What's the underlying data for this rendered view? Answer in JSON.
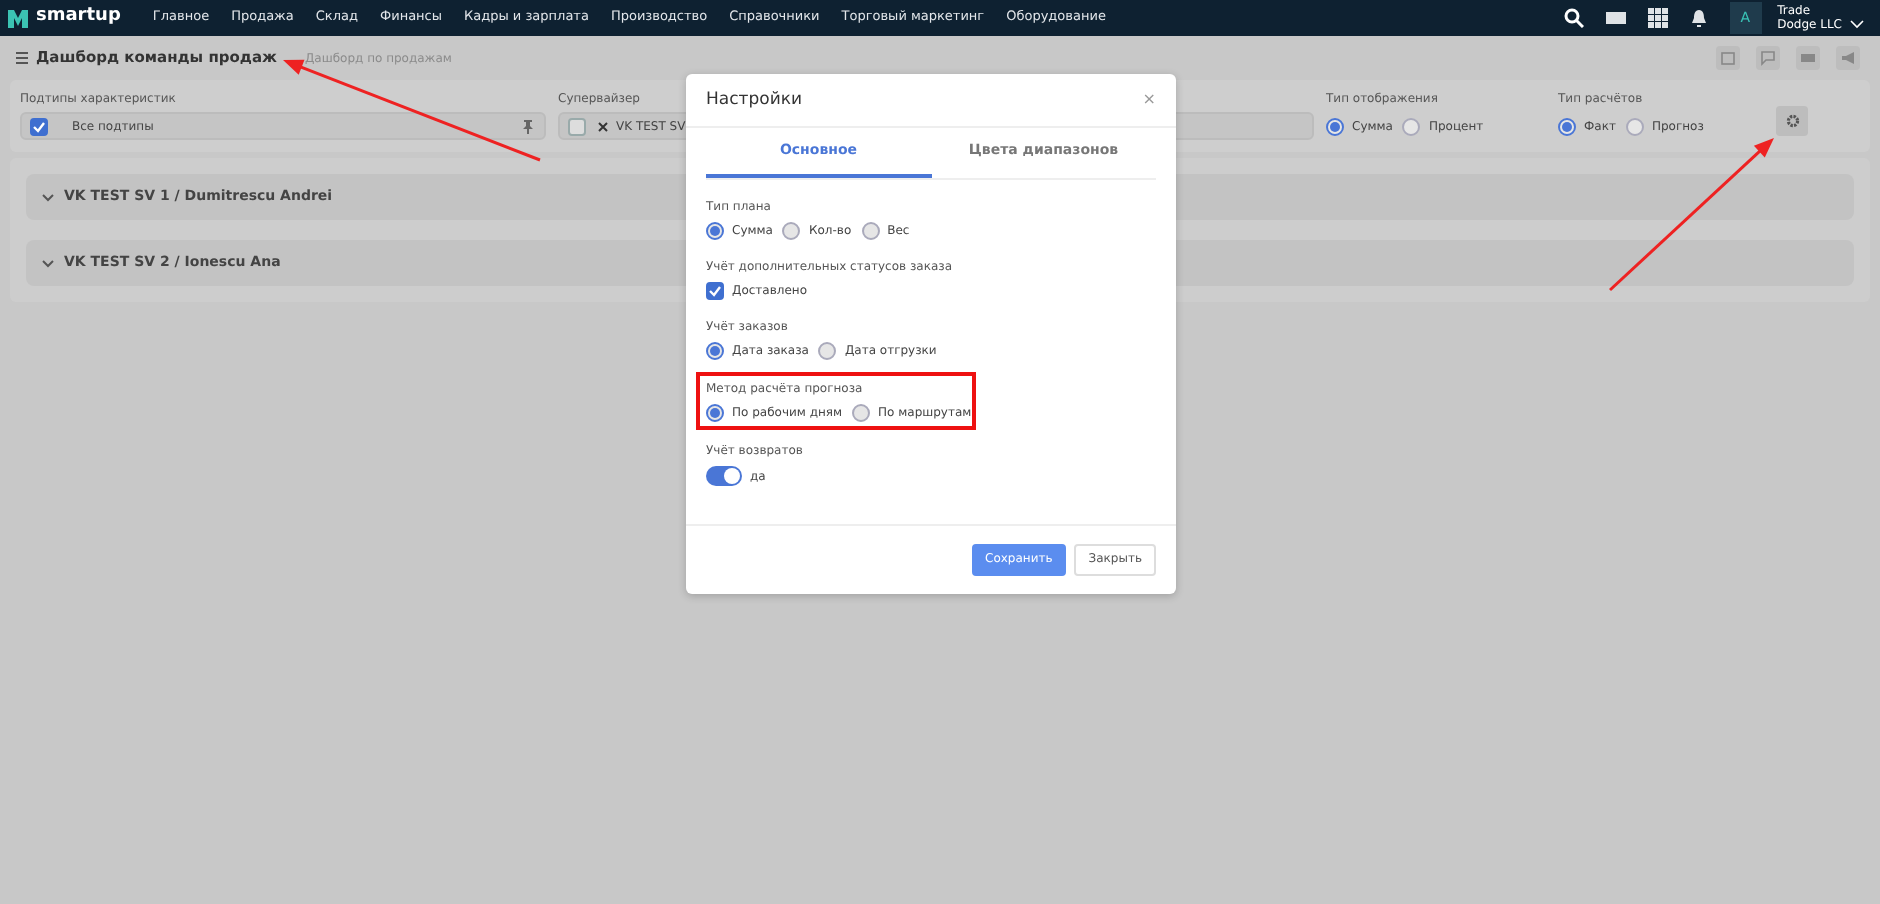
{
  "navbar": {
    "logo": "smartup",
    "menu": [
      "Главное",
      "Продажа",
      "Склад",
      "Финансы",
      "Кадры и зарплата",
      "Производство",
      "Справочники",
      "Торговый маркетинг",
      "Оборудование"
    ],
    "user": {
      "avatar": "A",
      "name": "Trade",
      "company": "Dodge LLC"
    }
  },
  "breadcrumbs": {
    "title": "Дашборд команды продаж",
    "link": "Дашборд по продажам"
  },
  "filters": {
    "subtypes": {
      "label": "Подтипы характеристик",
      "checked": true,
      "value": "Все подтипы"
    },
    "supervisor": {
      "label": "Супервайзер",
      "checked": false,
      "tag": "VK TEST SV"
    },
    "display_type": {
      "label": "Тип отображения",
      "options": [
        {
          "label": "Сумма",
          "selected": true
        },
        {
          "label": "Процент",
          "selected": false
        }
      ]
    },
    "calc_type": {
      "label": "Тип расчётов",
      "options": [
        {
          "label": "Факт",
          "selected": true
        },
        {
          "label": "Прогноз",
          "selected": false
        }
      ]
    }
  },
  "groups": [
    {
      "title": "VK TEST SV 1 / Dumitrescu Andrei"
    },
    {
      "title": "VK TEST SV 2 / Ionescu Ana"
    }
  ],
  "modal": {
    "title": "Настройки",
    "close": "×",
    "tabs": [
      {
        "label": "Основное",
        "selected": true
      },
      {
        "label": "Цвета диапазонов",
        "selected": false
      }
    ],
    "sections": [
      {
        "kind": "radio",
        "label": "Тип плана",
        "highlighted": false,
        "options": [
          {
            "label": "Сумма",
            "selected": true
          },
          {
            "label": "Кол-во",
            "selected": false
          },
          {
            "label": "Вес",
            "selected": false
          }
        ]
      },
      {
        "kind": "checkbox",
        "label": "Учёт дополнительных статусов заказа",
        "highlighted": false,
        "options": [
          {
            "label": "Доставлено",
            "checked": true
          }
        ]
      },
      {
        "kind": "radio",
        "label": "Учёт заказов",
        "highlighted": false,
        "options": [
          {
            "label": "Дата заказа",
            "selected": true
          },
          {
            "label": "Дата отгрузки",
            "selected": false
          }
        ]
      },
      {
        "kind": "radio",
        "label": "Метод расчёта прогноза",
        "highlighted": true,
        "options": [
          {
            "label": "По рабочим дням",
            "selected": true
          },
          {
            "label": "По маршрутам",
            "selected": false
          }
        ]
      },
      {
        "kind": "switch",
        "label": "Учёт возвратов",
        "highlighted": false,
        "on": true,
        "text": "да"
      }
    ],
    "buttons": [
      {
        "label": "Сохранить",
        "kind": "primary"
      },
      {
        "label": "Закрыть",
        "kind": "secondary"
      }
    ]
  }
}
